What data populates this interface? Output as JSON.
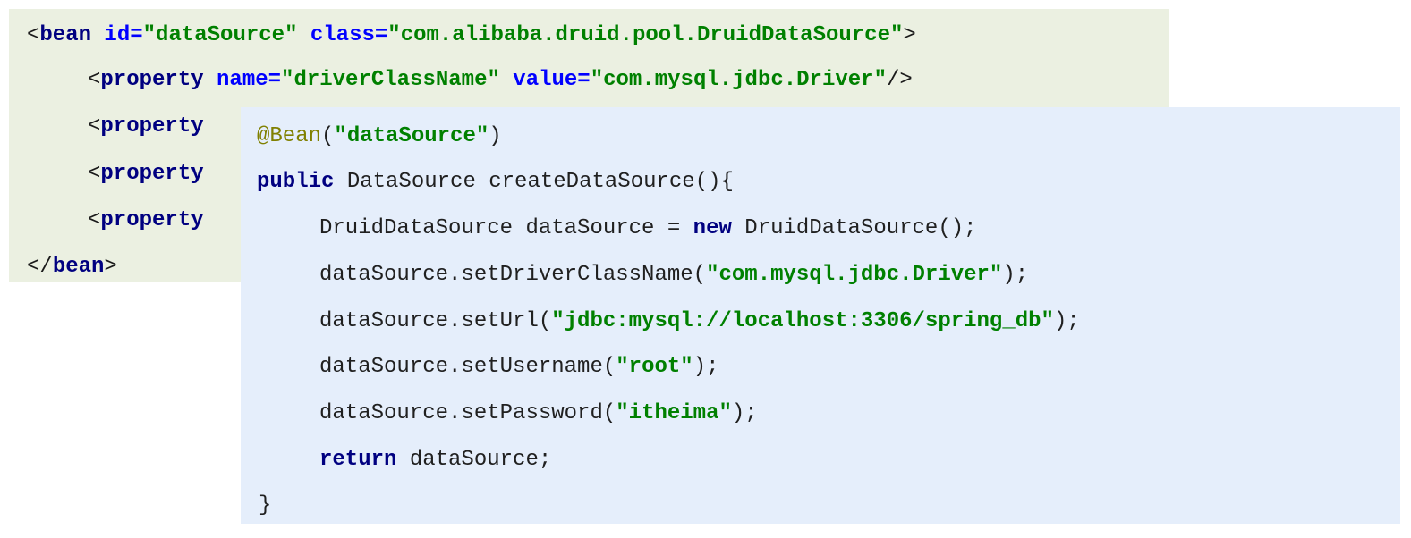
{
  "xml_block": {
    "line1": {
      "lt": "<",
      "tag": "bean",
      "attr_id": "id=",
      "val_id": "\"dataSource\"",
      "attr_class": "class=",
      "val_class": "\"com.alibaba.druid.pool.DruidDataSource\"",
      "gt": ">"
    },
    "line2": {
      "lt": "<",
      "tag": "property",
      "attr_name": "name=",
      "val_name": "\"driverClassName\"",
      "attr_value": "value=",
      "val_value": "\"com.mysql.jdbc.Driver\"",
      "end": "/>"
    },
    "line3": {
      "lt": "<",
      "tag": "property"
    },
    "line4": {
      "lt": "<",
      "tag": "property"
    },
    "line5": {
      "lt": "<",
      "tag": "property"
    },
    "line6": {
      "lt": "</",
      "tag": "bean",
      "gt": ">"
    }
  },
  "java_block": {
    "line1": {
      "annotation": "@Bean",
      "open": "(",
      "str": "\"dataSource\"",
      "close": ")"
    },
    "line2": {
      "kw": "public",
      "rest": " DataSource createDataSource(){"
    },
    "line3": {
      "pre": "DruidDataSource dataSource = ",
      "kw": "new",
      "post": " DruidDataSource();"
    },
    "line4": {
      "pre": "dataSource.setDriverClassName(",
      "str": "\"com.mysql.jdbc.Driver\"",
      "post": ");"
    },
    "line5": {
      "pre": "dataSource.setUrl(",
      "str": "\"jdbc:mysql://localhost:3306/spring_db\"",
      "post": ");"
    },
    "line6": {
      "pre": "dataSource.setUsername(",
      "str": "\"root\"",
      "post": ");"
    },
    "line7": {
      "pre": "dataSource.setPassword(",
      "str": "\"itheima\"",
      "post": ");"
    },
    "line8": {
      "kw": "return",
      "post": " dataSource;"
    },
    "line9": {
      "brace": "}"
    }
  }
}
